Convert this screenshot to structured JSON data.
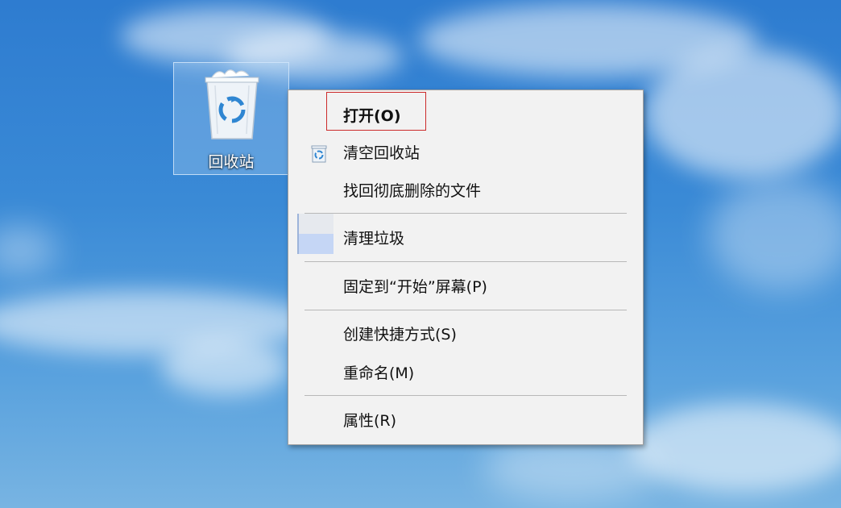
{
  "desktop": {
    "recycle_bin_label": "回收站"
  },
  "context_menu": {
    "items": [
      {
        "label": "打开(O)"
      },
      {
        "label": "清空回收站"
      },
      {
        "label": "找回彻底删除的文件"
      },
      {
        "label": "清理垃圾"
      },
      {
        "label": "固定到“开始”屏幕(P)"
      },
      {
        "label": "创建快捷方式(S)"
      },
      {
        "label": "重命名(M)"
      },
      {
        "label": "属性(R)"
      }
    ]
  },
  "colors": {
    "highlight_border": "#cc2b2b",
    "menu_background": "#f2f2f2"
  },
  "icons": [
    "recycle-bin-icon",
    "recycle-icon",
    "cleanup-icon"
  ]
}
